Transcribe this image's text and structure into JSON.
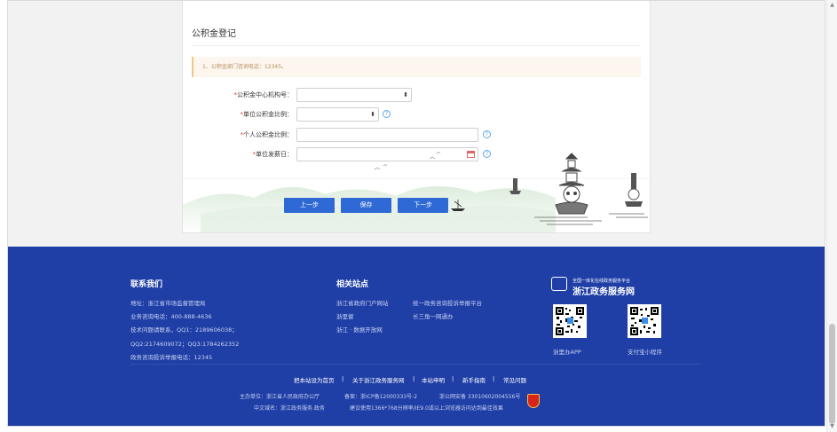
{
  "form": {
    "title": "公积金登记",
    "notice": "1、公积金部门咨询电话：12345。",
    "fields": [
      {
        "label": "公积金中心机构号：",
        "required": "*",
        "type": "select"
      },
      {
        "label": "单位公积金比例：",
        "required": "*",
        "type": "select"
      },
      {
        "label": "个人公积金比例：",
        "required": "*",
        "type": "text"
      },
      {
        "label": "单位发薪日：",
        "required": "*",
        "type": "date"
      }
    ],
    "help_icon": "?",
    "buttons": {
      "prev": "上一步",
      "save": "保存",
      "next": "下一步"
    }
  },
  "footer": {
    "contact": {
      "title": "联系我们",
      "lines": [
        "地址：浙江省市场监督管理局",
        "业务咨询电话：400-888-4636",
        "技术问题请联系，QQ1：2189606038；",
        "QQ2:2174609072；QQ3:1784262352",
        "政务咨询投诉举报电话：12345"
      ]
    },
    "related": {
      "title": "相关站点",
      "col1": [
        "浙江省政府门户网站",
        "浙里督",
        "浙江 · 数据开放网"
      ],
      "col2": [
        "统一政务咨询投诉举报平台",
        "长三角一网通办"
      ]
    },
    "brand": {
      "small": "全国一体化在线政务服务平台",
      "big": "浙江政务服务网",
      "qr1_label": "浙里办APP",
      "qr2_label": "支付宝小程序"
    },
    "links": [
      "把本站设为首页",
      "关于浙江政务服务网",
      "本站申明",
      "新手指南",
      "常见问题"
    ],
    "separator": "|",
    "bottom": {
      "sponsor": "主办单位：浙江省人民政府办公厅",
      "icp": "备案：浙ICP备12000333号-2",
      "police": "浙公网安备 33010602004556号",
      "domain": "中文域名：浙江政务服务.政务",
      "advice": "建议使用1366*768分辨率/IE9.0或以上浏览器访问达到最佳效果"
    }
  },
  "colors": {
    "accent": "#2f69d6",
    "footer": "#1f3ea6",
    "required": "#e33"
  }
}
